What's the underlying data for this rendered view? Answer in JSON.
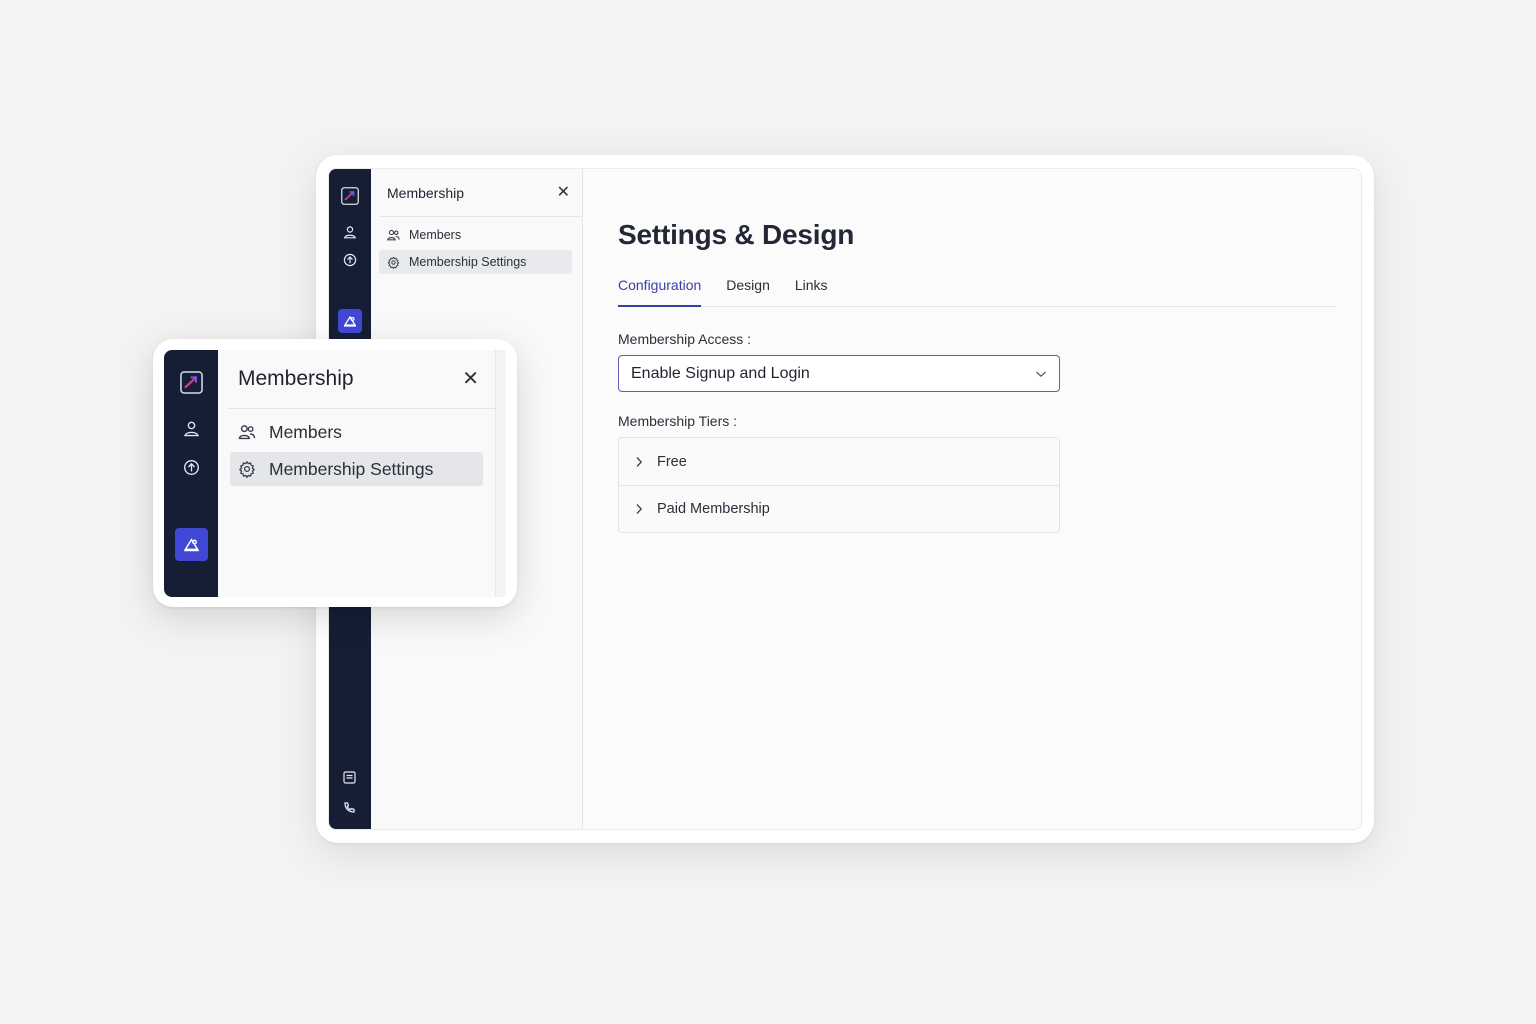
{
  "colors": {
    "rail_bg": "#161e36",
    "active_icon_bg": "#4148d6",
    "accent": "#3a3fa8",
    "select_border": "#5e5fb4"
  },
  "panel": {
    "title": "Membership",
    "items": [
      {
        "label": "Members",
        "icon": "users-icon"
      },
      {
        "label": "Membership Settings",
        "icon": "gear-icon",
        "active": true
      }
    ]
  },
  "main": {
    "title": "Settings & Design",
    "tabs": [
      {
        "label": "Configuration",
        "active": true
      },
      {
        "label": "Design"
      },
      {
        "label": "Links"
      }
    ],
    "access": {
      "label": "Membership Access :",
      "value": "Enable Signup and Login"
    },
    "tiers": {
      "label": "Membership Tiers :",
      "items": [
        {
          "label": "Free"
        },
        {
          "label": "Paid Membership"
        }
      ]
    }
  }
}
